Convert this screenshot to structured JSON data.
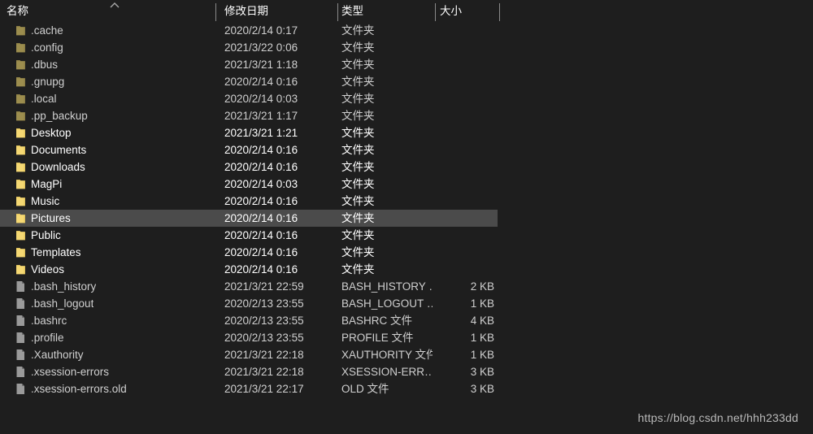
{
  "window": {
    "background_color": "#1e1e1e",
    "selection_color": "#4b4b4b"
  },
  "header": {
    "columns": [
      {
        "key": "name",
        "label": "名称"
      },
      {
        "key": "date",
        "label": "修改日期"
      },
      {
        "key": "type",
        "label": "类型"
      },
      {
        "key": "size",
        "label": "大小"
      }
    ],
    "sort_column": "名称",
    "sort_direction": "ascending",
    "sort_icon": "chevron-up-icon"
  },
  "rows": [
    {
      "icon": "folder-icon-dim",
      "name": ".cache",
      "date": "2020/2/14 0:17",
      "type": "文件夹",
      "size": "",
      "hidden": true,
      "selected": false
    },
    {
      "icon": "folder-icon-dim",
      "name": ".config",
      "date": "2021/3/22 0:06",
      "type": "文件夹",
      "size": "",
      "hidden": true,
      "selected": false
    },
    {
      "icon": "folder-icon-dim",
      "name": ".dbus",
      "date": "2021/3/21 1:18",
      "type": "文件夹",
      "size": "",
      "hidden": true,
      "selected": false
    },
    {
      "icon": "folder-icon-dim",
      "name": ".gnupg",
      "date": "2020/2/14 0:16",
      "type": "文件夹",
      "size": "",
      "hidden": true,
      "selected": false
    },
    {
      "icon": "folder-icon-dim",
      "name": ".local",
      "date": "2020/2/14 0:03",
      "type": "文件夹",
      "size": "",
      "hidden": true,
      "selected": false
    },
    {
      "icon": "folder-icon-dim",
      "name": ".pp_backup",
      "date": "2021/3/21 1:17",
      "type": "文件夹",
      "size": "",
      "hidden": true,
      "selected": false
    },
    {
      "icon": "folder-icon",
      "name": "Desktop",
      "date": "2021/3/21 1:21",
      "type": "文件夹",
      "size": "",
      "hidden": false,
      "selected": false
    },
    {
      "icon": "folder-icon",
      "name": "Documents",
      "date": "2020/2/14 0:16",
      "type": "文件夹",
      "size": "",
      "hidden": false,
      "selected": false
    },
    {
      "icon": "folder-icon",
      "name": "Downloads",
      "date": "2020/2/14 0:16",
      "type": "文件夹",
      "size": "",
      "hidden": false,
      "selected": false
    },
    {
      "icon": "folder-icon",
      "name": "MagPi",
      "date": "2020/2/14 0:03",
      "type": "文件夹",
      "size": "",
      "hidden": false,
      "selected": false
    },
    {
      "icon": "folder-icon",
      "name": "Music",
      "date": "2020/2/14 0:16",
      "type": "文件夹",
      "size": "",
      "hidden": false,
      "selected": false
    },
    {
      "icon": "folder-icon",
      "name": "Pictures",
      "date": "2020/2/14 0:16",
      "type": "文件夹",
      "size": "",
      "hidden": false,
      "selected": true
    },
    {
      "icon": "folder-icon",
      "name": "Public",
      "date": "2020/2/14 0:16",
      "type": "文件夹",
      "size": "",
      "hidden": false,
      "selected": false
    },
    {
      "icon": "folder-icon",
      "name": "Templates",
      "date": "2020/2/14 0:16",
      "type": "文件夹",
      "size": "",
      "hidden": false,
      "selected": false
    },
    {
      "icon": "folder-icon",
      "name": "Videos",
      "date": "2020/2/14 0:16",
      "type": "文件夹",
      "size": "",
      "hidden": false,
      "selected": false
    },
    {
      "icon": "file-icon",
      "name": ".bash_history",
      "date": "2021/3/21 22:59",
      "type": "BASH_HISTORY …",
      "size": "2 KB",
      "hidden": true,
      "selected": false
    },
    {
      "icon": "file-icon",
      "name": ".bash_logout",
      "date": "2020/2/13 23:55",
      "type": "BASH_LOGOUT …",
      "size": "1 KB",
      "hidden": true,
      "selected": false
    },
    {
      "icon": "file-icon",
      "name": ".bashrc",
      "date": "2020/2/13 23:55",
      "type": "BASHRC 文件",
      "size": "4 KB",
      "hidden": true,
      "selected": false
    },
    {
      "icon": "file-icon",
      "name": ".profile",
      "date": "2020/2/13 23:55",
      "type": "PROFILE 文件",
      "size": "1 KB",
      "hidden": true,
      "selected": false
    },
    {
      "icon": "file-icon",
      "name": ".Xauthority",
      "date": "2021/3/21 22:18",
      "type": "XAUTHORITY 文件",
      "size": "1 KB",
      "hidden": true,
      "selected": false
    },
    {
      "icon": "file-icon",
      "name": ".xsession-errors",
      "date": "2021/3/21 22:18",
      "type": "XSESSION-ERR…",
      "size": "3 KB",
      "hidden": true,
      "selected": false
    },
    {
      "icon": "file-icon",
      "name": ".xsession-errors.old",
      "date": "2021/3/21 22:17",
      "type": "OLD 文件",
      "size": "3 KB",
      "hidden": true,
      "selected": false
    }
  ],
  "watermark": {
    "text": "https://blog.csdn.net/hhh233dd"
  }
}
